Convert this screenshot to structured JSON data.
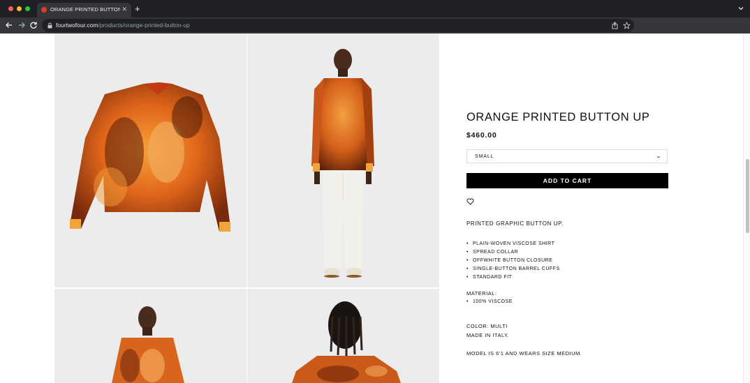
{
  "browser": {
    "tab_title": "ORANGE PRINTED BUTTON UP",
    "url_host": "fourtwofour.com",
    "url_path": "/products/orange-printed-button-up"
  },
  "product": {
    "title": "ORANGE PRINTED BUTTON UP",
    "price": "$460.00",
    "size_selected": "SMALL",
    "add_to_cart_label": "ADD TO CART",
    "description": "PRINTED GRAPHIC BUTTON UP.",
    "features": [
      "PLAIN-WOVEN VISCOSE SHIRT",
      "SPREAD COLLAR",
      "OFFWHITE BUTTON CLOSURE",
      "SINGLE-BUTTON BARREL CUFFS",
      "STANDARD FIT"
    ],
    "material_label": "MATERIAL:",
    "materials": [
      "100% VISCOSE"
    ],
    "color": "COLOR: MULTI",
    "origin": "MADE IN ITALY.",
    "model_note": "MODEL IS 6'1 AND WEARS SIZE MEDIUM."
  },
  "icons": {
    "back": "arrow-left-icon",
    "forward": "arrow-right-icon",
    "reload": "reload-icon",
    "lock": "lock-icon",
    "share": "share-icon",
    "bookmark": "star-icon",
    "wishlist": "heart-icon",
    "dropdown": "chevron-down-icon"
  },
  "colors": {
    "chrome_bg": "#1f2023",
    "toolbar_bg": "#35363a",
    "button_bg": "#000000",
    "shirt_orange": "#e8741c"
  }
}
